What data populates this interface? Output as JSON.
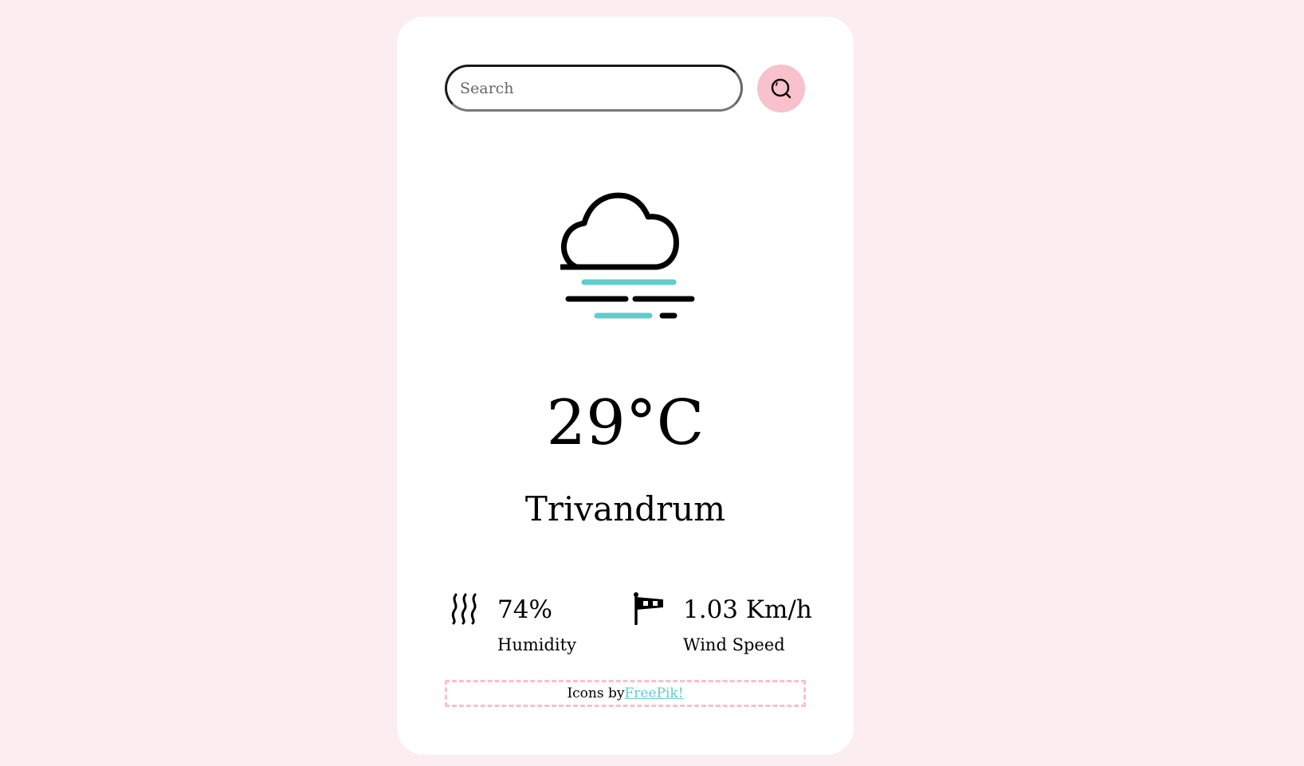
{
  "search": {
    "placeholder": "Search",
    "value": "",
    "button_icon": "search-icon"
  },
  "weather": {
    "icon": "mist-cloud-icon",
    "temperature": "29°C",
    "city": "Trivandrum"
  },
  "stats": {
    "humidity": {
      "icon": "humidity-icon",
      "value": "74%",
      "label": "Humidity"
    },
    "wind": {
      "icon": "windsock-icon",
      "value": "1.03 Km/h",
      "label": "Wind Speed"
    }
  },
  "credit": {
    "prefix": "Icons by",
    "link_text": "FreePik!"
  },
  "colors": {
    "background": "#fcedf1",
    "card": "#ffffff",
    "accent_pink": "#f8c1cb",
    "accent_teal": "#5ecdcb"
  }
}
